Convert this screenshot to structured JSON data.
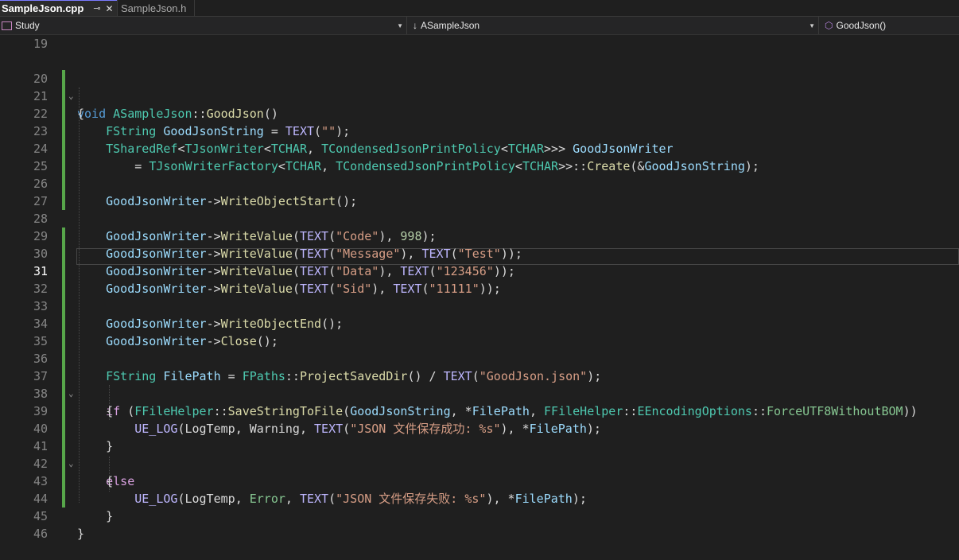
{
  "tabs": [
    {
      "label": "SampleJson.cpp",
      "active": true
    },
    {
      "label": "SampleJson.h",
      "active": false
    }
  ],
  "navbar": {
    "project": "Study",
    "class": "ASampleJson",
    "member": "GoodJson()"
  },
  "editor": {
    "current_line": 31,
    "line_numbers": [
      "19",
      "20",
      "21",
      "22",
      "23",
      "24",
      "25",
      "26",
      "27",
      "28",
      "29",
      "30",
      "31",
      "32",
      "33",
      "34",
      "35",
      "36",
      "37",
      "38",
      "39",
      "40",
      "41",
      "42",
      "43",
      "44",
      "45",
      "46"
    ]
  },
  "code": {
    "t20": [
      "void",
      "ASampleJson",
      "::",
      "GoodJson",
      "()"
    ],
    "t21": [
      "{"
    ],
    "t22": [
      "FString",
      "GoodJsonString",
      " = ",
      "TEXT",
      "(",
      "\"\"",
      ");"
    ],
    "t23": [
      "TSharedRef",
      "<",
      "TJsonWriter",
      "<",
      "TCHAR",
      ", ",
      "TCondensedJsonPrintPolicy",
      "<",
      "TCHAR",
      ">>>",
      " ",
      "GoodJsonWriter"
    ],
    "t24": [
      "= ",
      "TJsonWriterFactory",
      "<",
      "TCHAR",
      ", ",
      "TCondensedJsonPrintPolicy",
      "<",
      "TCHAR",
      ">>::",
      "Create",
      "(&",
      "GoodJsonString",
      ");"
    ],
    "t26": [
      "GoodJsonWriter",
      "->",
      "WriteObjectStart",
      "();"
    ],
    "t28": [
      "GoodJsonWriter",
      "->",
      "WriteValue",
      "(",
      "TEXT",
      "(",
      "\"Code\"",
      "), ",
      "998",
      ");"
    ],
    "t29": [
      "GoodJsonWriter",
      "->",
      "WriteValue",
      "(",
      "TEXT",
      "(",
      "\"Message\"",
      "), ",
      "TEXT",
      "(",
      "\"Test\"",
      "));"
    ],
    "t30": [
      "GoodJsonWriter",
      "->",
      "WriteValue",
      "(",
      "TEXT",
      "(",
      "\"Data\"",
      "), ",
      "TEXT",
      "(",
      "\"123456\"",
      "));"
    ],
    "t31": [
      "GoodJsonWriter",
      "->",
      "WriteValue",
      "(",
      "TEXT",
      "(",
      "\"Sid\"",
      "), ",
      "TEXT",
      "(",
      "\"11111\"",
      "));"
    ],
    "t33": [
      "GoodJsonWriter",
      "->",
      "WriteObjectEnd",
      "();"
    ],
    "t34": [
      "GoodJsonWriter",
      "->",
      "Close",
      "();"
    ],
    "t36": [
      "FString",
      "FilePath",
      " = ",
      "FPaths",
      "::",
      "ProjectSavedDir",
      "() / ",
      "TEXT",
      "(",
      "\"GoodJson.json\"",
      ");"
    ],
    "t37": [
      "if",
      " (",
      "FFileHelper",
      "::",
      "SaveStringToFile",
      "(",
      "GoodJsonString",
      ", *",
      "FilePath",
      ", ",
      "FFileHelper",
      "::",
      "EEncodingOptions",
      "::",
      "ForceUTF8WithoutBOM",
      "))"
    ],
    "t38": [
      "{"
    ],
    "t39": [
      "UE_LOG",
      "(",
      "LogTemp",
      ", ",
      "Warning",
      ", ",
      "TEXT",
      "(",
      "\"JSON 文件保存成功: %s\"",
      "), *",
      "FilePath",
      ");"
    ],
    "t40": [
      "}"
    ],
    "t41": [
      "else"
    ],
    "t42": [
      "{"
    ],
    "t43": [
      "UE_LOG",
      "(",
      "LogTemp",
      ", ",
      "Error",
      ", ",
      "TEXT",
      "(",
      "\"JSON 文件保存失败: %s\"",
      "), *",
      "FilePath",
      ");"
    ],
    "t44": [
      "}"
    ],
    "t45": [
      "}"
    ]
  },
  "colors": {
    "background": "#1f1f1f",
    "keyword": "#569cd6",
    "control_keyword": "#d8a0df",
    "type": "#4ec9b0",
    "function": "#dcdcaa",
    "macro": "#beb7ff",
    "string": "#d69d85",
    "number": "#b5cea8",
    "variable": "#9cdcfe",
    "enum": "#86c691",
    "changed_marker": "#57a64a"
  }
}
